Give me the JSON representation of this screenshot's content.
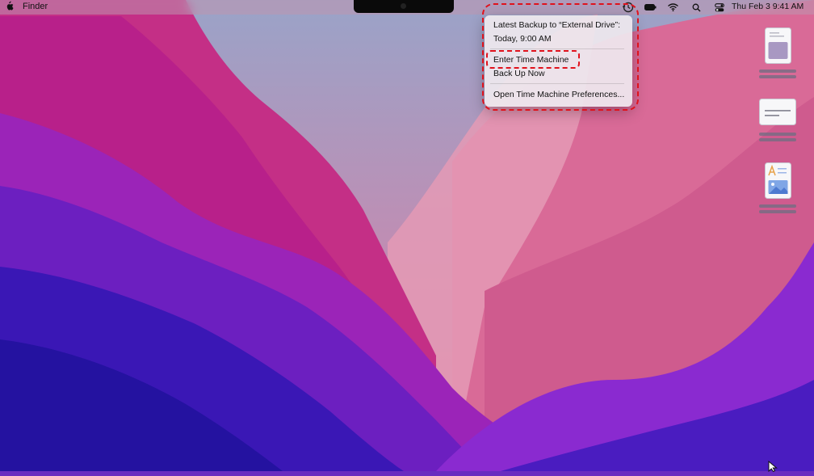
{
  "menubar": {
    "apple_icon": "apple-logo-icon",
    "app_name": "Finder",
    "status_icons": [
      "time-machine-icon",
      "battery-icon",
      "wifi-icon",
      "search-icon",
      "control-center-icon"
    ],
    "clock": "Thu Feb 3  9:41 AM"
  },
  "time_machine_menu": {
    "info_line_1": "Latest Backup to “External Drive”:",
    "info_line_2": "Today, 9:00 AM",
    "items": [
      {
        "label": "Enter Time Machine"
      },
      {
        "label": "Back Up Now"
      },
      {
        "label": "Open Time Machine Preferences..."
      }
    ]
  },
  "desktop_files": [
    {
      "icon": "document-icon"
    },
    {
      "icon": "text-file-icon"
    },
    {
      "icon": "image-document-icon"
    }
  ],
  "colors": {
    "highlight": "#e0121c"
  }
}
